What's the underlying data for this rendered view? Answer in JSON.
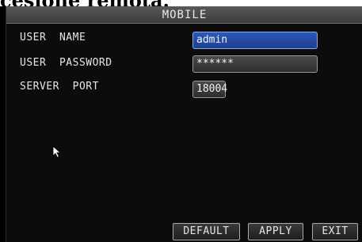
{
  "page_heading": "cesione remota.",
  "window": {
    "title": "MOBILE"
  },
  "form": {
    "user_name": {
      "label": "USER  NAME",
      "value": "admin"
    },
    "user_password": {
      "label": "USER  PASSWORD",
      "value": "******"
    },
    "server_port": {
      "label": "SERVER  PORT",
      "value": "18004"
    }
  },
  "buttons": {
    "default_label": "DEFAULT",
    "apply_label": "APPLY",
    "exit_label": "EXIT"
  },
  "icons": {
    "cursor": "mouse-pointer-icon"
  },
  "colors": {
    "selected_field": "#2c59b8",
    "panel_background": "#0c0c0c",
    "title_bar": "#4a4a4a"
  }
}
